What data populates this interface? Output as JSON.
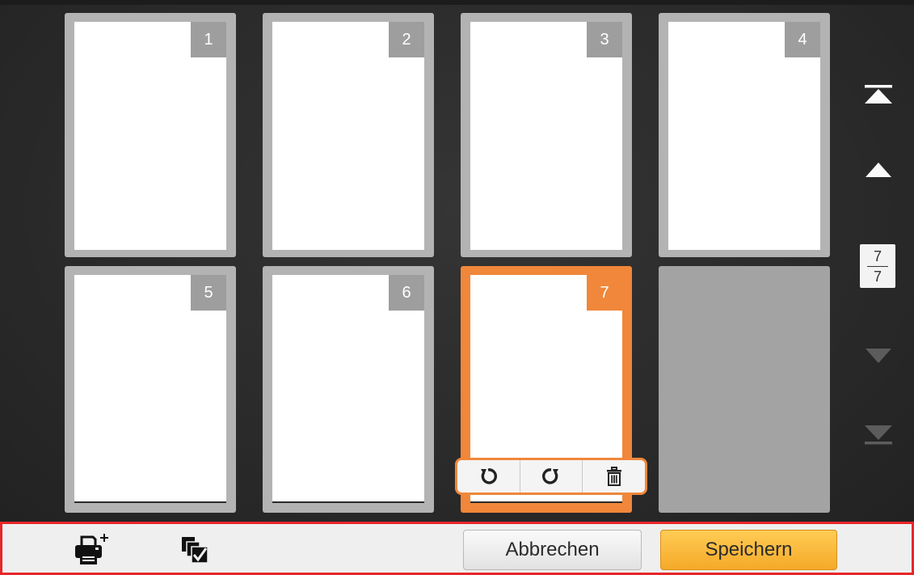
{
  "pages": [
    {
      "number": "1",
      "state": "normal"
    },
    {
      "number": "2",
      "state": "normal"
    },
    {
      "number": "3",
      "state": "normal"
    },
    {
      "number": "4",
      "state": "normal"
    },
    {
      "number": "5",
      "state": "normal"
    },
    {
      "number": "6",
      "state": "normal"
    },
    {
      "number": "7",
      "state": "selected"
    },
    {
      "number": "",
      "state": "empty"
    }
  ],
  "page_toolbar": {
    "icons": [
      "rotate-left-icon",
      "rotate-right-icon",
      "trash-icon"
    ]
  },
  "pager": {
    "current": "7",
    "total": "7",
    "icons": [
      "first-page-icon",
      "page-up-icon",
      "page-down-icon",
      "last-page-icon"
    ]
  },
  "bottom_bar": {
    "icons": [
      "add-scan-icon",
      "select-pages-icon"
    ],
    "cancel_label": "Abbrechen",
    "save_label": "Speichern"
  },
  "colors": {
    "accent": "#f0873a",
    "tile": "#b3b3b3",
    "save_button": "#f9b53a",
    "bottom_border": "#e8262a"
  }
}
